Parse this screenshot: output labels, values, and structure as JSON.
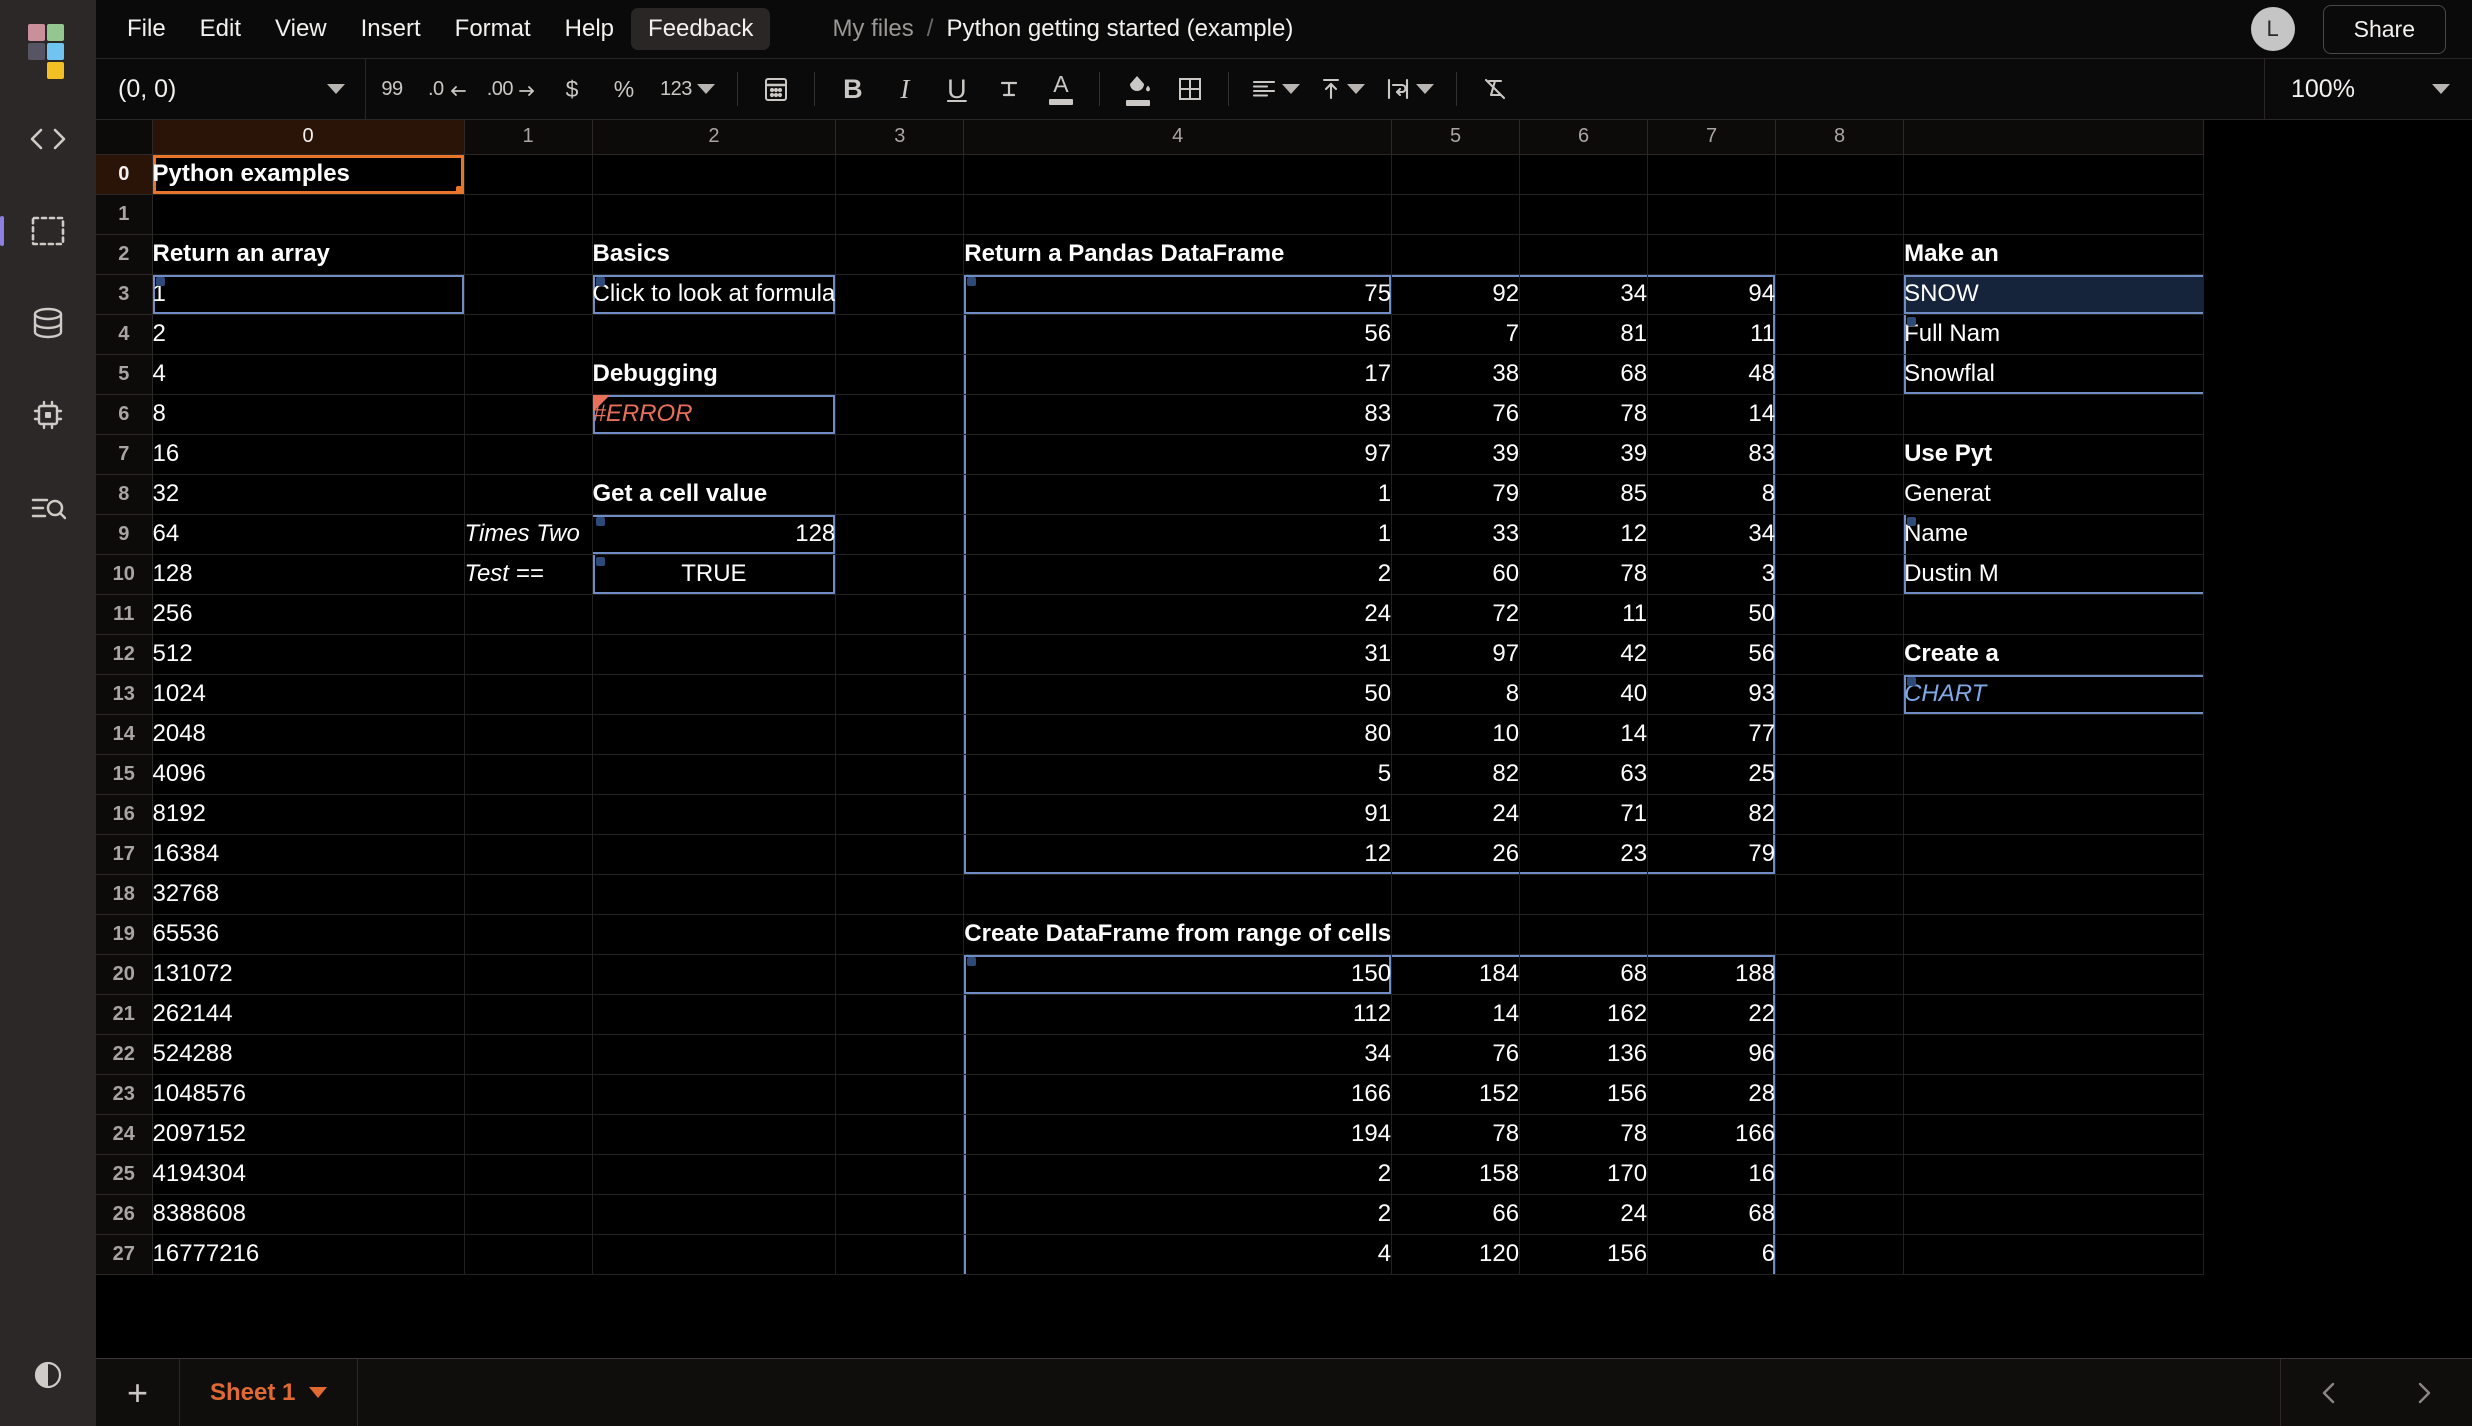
{
  "app": {
    "logo_name": "app-logo",
    "logo_colors": [
      "#c98f9b",
      "#94c68f",
      "#575463",
      "#70c5f0",
      "#f2c023"
    ]
  },
  "rail": {
    "items": [
      {
        "icon": "code-brackets-icon",
        "label": "Code"
      },
      {
        "icon": "selection-box-icon",
        "label": "Selection"
      },
      {
        "icon": "database-icon",
        "label": "Data"
      },
      {
        "icon": "chip-icon",
        "label": "Compute"
      },
      {
        "icon": "search-list-icon",
        "label": "Search"
      }
    ],
    "bottom_item": {
      "icon": "theme-toggle-icon",
      "label": "Theme"
    }
  },
  "menubar": {
    "items": [
      {
        "label": "File",
        "active": false
      },
      {
        "label": "Edit",
        "active": false
      },
      {
        "label": "View",
        "active": false
      },
      {
        "label": "Insert",
        "active": false
      },
      {
        "label": "Format",
        "active": false
      },
      {
        "label": "Help",
        "active": false
      },
      {
        "label": "Feedback",
        "active": true
      }
    ],
    "breadcrumb": {
      "parent": "My files",
      "separator": "/",
      "title": "Python getting started (example)"
    },
    "avatar_initial": "L",
    "share_label": "Share"
  },
  "toolbar": {
    "cell_reference": "(0, 0)",
    "zoom_level": "100%",
    "buttons": [
      {
        "name": "format-99",
        "glyph": "99"
      },
      {
        "name": "decrease-decimal",
        "glyph": ".0"
      },
      {
        "name": "increase-decimal",
        "glyph": ".00"
      },
      {
        "name": "currency-format",
        "glyph": "$"
      },
      {
        "name": "percent-format",
        "glyph": "%"
      },
      {
        "name": "number-format",
        "glyph": "123"
      },
      {
        "name": "date-format",
        "glyph": "calendar"
      },
      {
        "name": "bold",
        "glyph": "B"
      },
      {
        "name": "italic",
        "glyph": "I"
      },
      {
        "name": "underline",
        "glyph": "U"
      },
      {
        "name": "strikethrough",
        "glyph": "S"
      },
      {
        "name": "text-color",
        "glyph": "A"
      },
      {
        "name": "fill-color",
        "glyph": "paint-drop"
      },
      {
        "name": "borders",
        "glyph": "grid"
      },
      {
        "name": "horizontal-align",
        "glyph": "align-lines"
      },
      {
        "name": "vertical-align",
        "glyph": "arrow-up"
      },
      {
        "name": "text-wrap",
        "glyph": "wrap"
      },
      {
        "name": "clear-formatting",
        "glyph": "clear"
      }
    ]
  },
  "grid": {
    "column_headers": [
      "0",
      "1",
      "2",
      "3",
      "4",
      "5",
      "6",
      "7",
      "8"
    ],
    "selected_column": "0",
    "selected_row": "0",
    "row_headers": [
      "0",
      "1",
      "2",
      "3",
      "4",
      "5",
      "6",
      "7",
      "8",
      "9",
      "10",
      "11",
      "12",
      "13",
      "14",
      "15",
      "16",
      "17",
      "18",
      "19",
      "20",
      "21",
      "22",
      "23",
      "24",
      "25",
      "26",
      "27"
    ],
    "col_a": {
      "title": "Python examples",
      "section": "Return an array",
      "values": [
        "1",
        "2",
        "4",
        "8",
        "16",
        "32",
        "64",
        "128",
        "256",
        "512",
        "1024",
        "2048",
        "4096",
        "8192",
        "16384",
        "32768",
        "65536",
        "131072",
        "262144",
        "524288",
        "1048576",
        "2097152",
        "4194304",
        "8388608",
        "16777216"
      ]
    },
    "col_b": {
      "times_two_label": "Times Two",
      "test_label": "Test =="
    },
    "col_c": {
      "basics_title": "Basics",
      "basics_value": "Click to look at formula",
      "debugging_title": "Debugging",
      "debugging_value": "#ERROR",
      "getcell_title": "Get a cell value",
      "getcell_value_1": "128",
      "getcell_value_2": "TRUE"
    },
    "pandas": {
      "title": "Return a Pandas DataFrame",
      "rows": [
        [
          "75",
          "92",
          "34",
          "94"
        ],
        [
          "56",
          "7",
          "81",
          "11"
        ],
        [
          "17",
          "38",
          "68",
          "48"
        ],
        [
          "83",
          "76",
          "78",
          "14"
        ],
        [
          "97",
          "39",
          "39",
          "83"
        ],
        [
          "1",
          "79",
          "85",
          "8"
        ],
        [
          "1",
          "33",
          "12",
          "34"
        ],
        [
          "2",
          "60",
          "78",
          "3"
        ],
        [
          "24",
          "72",
          "11",
          "50"
        ],
        [
          "31",
          "97",
          "42",
          "56"
        ],
        [
          "50",
          "8",
          "40",
          "93"
        ],
        [
          "80",
          "10",
          "14",
          "77"
        ],
        [
          "5",
          "82",
          "63",
          "25"
        ],
        [
          "91",
          "24",
          "71",
          "82"
        ],
        [
          "12",
          "26",
          "23",
          "79"
        ]
      ]
    },
    "range_df": {
      "title": "Create DataFrame from range of cells",
      "rows": [
        [
          "150",
          "184",
          "68",
          "188"
        ],
        [
          "112",
          "14",
          "162",
          "22"
        ],
        [
          "34",
          "76",
          "136",
          "96"
        ],
        [
          "166",
          "152",
          "156",
          "28"
        ],
        [
          "194",
          "78",
          "78",
          "166"
        ],
        [
          "2",
          "158",
          "170",
          "16"
        ],
        [
          "2",
          "66",
          "24",
          "68"
        ],
        [
          "4",
          "120",
          "156",
          "6"
        ]
      ]
    },
    "col_h": {
      "make_title": "Make an",
      "make_value_1": "SNOW",
      "make_value_2": "Full Nam",
      "make_value_3": "Snowflal",
      "python_title": "Use Pyt",
      "python_value_1": "Generat",
      "python_value_2": "Name",
      "python_value_3": "Dustin M",
      "chart_title": "Create a",
      "chart_value": "CHART"
    }
  },
  "sheetbar": {
    "add_label": "+",
    "active_sheet": "Sheet 1",
    "prev_label": "prev-sheet",
    "next_label": "next-sheet"
  },
  "colors": {
    "accent_orange": "#e8752a",
    "sheet_orange": "#e06a32",
    "range_blue": "#6f8dc4",
    "error_red": "#e8705a",
    "link_blue": "#7fa9e8"
  }
}
